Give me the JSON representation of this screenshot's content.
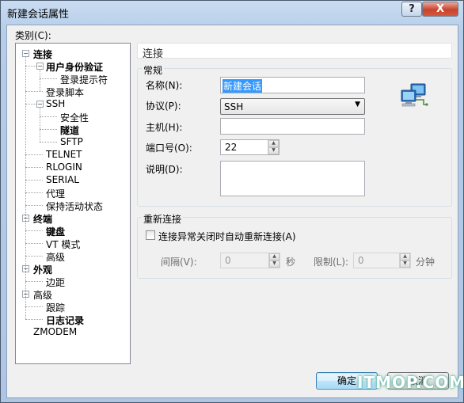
{
  "window": {
    "title": "新建会话属性",
    "help_label": "?",
    "close_label": "X"
  },
  "category_label": "类别(C):",
  "tree": [
    {
      "label": "连接",
      "bold": true,
      "level": 0,
      "expander": "−"
    },
    {
      "label": "用户身份验证",
      "bold": true,
      "level": 1,
      "expander": "−"
    },
    {
      "label": "登录提示符",
      "bold": false,
      "level": 2,
      "expander": ""
    },
    {
      "label": "登录脚本",
      "bold": false,
      "level": 1,
      "expander": ""
    },
    {
      "label": "SSH",
      "bold": false,
      "level": 1,
      "expander": "−"
    },
    {
      "label": "安全性",
      "bold": false,
      "level": 2,
      "expander": ""
    },
    {
      "label": "隧道",
      "bold": true,
      "level": 2,
      "expander": ""
    },
    {
      "label": "SFTP",
      "bold": false,
      "level": 2,
      "expander": ""
    },
    {
      "label": "TELNET",
      "bold": false,
      "level": 1,
      "expander": ""
    },
    {
      "label": "RLOGIN",
      "bold": false,
      "level": 1,
      "expander": ""
    },
    {
      "label": "SERIAL",
      "bold": false,
      "level": 1,
      "expander": ""
    },
    {
      "label": "代理",
      "bold": false,
      "level": 1,
      "expander": ""
    },
    {
      "label": "保持活动状态",
      "bold": false,
      "level": 1,
      "expander": ""
    },
    {
      "label": "终端",
      "bold": true,
      "level": 0,
      "expander": "−"
    },
    {
      "label": "键盘",
      "bold": true,
      "level": 1,
      "expander": ""
    },
    {
      "label": "VT 模式",
      "bold": false,
      "level": 1,
      "expander": ""
    },
    {
      "label": "高级",
      "bold": false,
      "level": 1,
      "expander": ""
    },
    {
      "label": "外观",
      "bold": true,
      "level": 0,
      "expander": "−"
    },
    {
      "label": "边距",
      "bold": false,
      "level": 1,
      "expander": ""
    },
    {
      "label": "高级",
      "bold": false,
      "level": 0,
      "expander": "−"
    },
    {
      "label": "跟踪",
      "bold": false,
      "level": 1,
      "expander": ""
    },
    {
      "label": "日志记录",
      "bold": true,
      "level": 1,
      "expander": ""
    },
    {
      "label": "ZMODEM",
      "bold": false,
      "level": 0,
      "expander": ""
    }
  ],
  "panel": {
    "title": "连接",
    "general": {
      "title": "常规",
      "name_label": "名称(N):",
      "name_value": "新建会话",
      "protocol_label": "协议(P):",
      "protocol_value": "SSH",
      "host_label": "主机(H):",
      "host_value": "",
      "port_label": "端口号(O):",
      "port_value": "22",
      "desc_label": "说明(D):",
      "desc_value": "",
      "icon": "network-computers-icon"
    },
    "reconnect": {
      "title": "重新连接",
      "checkbox_label": "连接异常关闭时自动重新连接(A)",
      "checked": false,
      "interval_label": "间隔(V):",
      "interval_value": "0",
      "interval_unit": "秒",
      "limit_label": "限制(L):",
      "limit_value": "0",
      "limit_unit": "分钟"
    }
  },
  "buttons": {
    "ok": "确定",
    "cancel": "取消"
  },
  "watermark": "ITMOP.COM"
}
